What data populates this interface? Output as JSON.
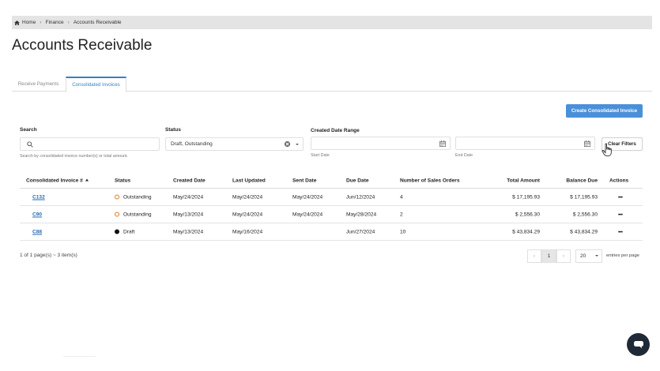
{
  "breadcrumb": {
    "home": "Home",
    "finance": "Finance",
    "current": "Accounts Receivable",
    "sep": "›"
  },
  "page": {
    "title": "Accounts Receivable"
  },
  "tabs": [
    {
      "label": "Receive Payments",
      "active": false
    },
    {
      "label": "Consolidated Invoices",
      "active": true
    }
  ],
  "actions": {
    "create_label": "Create Consolidated Invoice",
    "clear_label": "Clear Filters"
  },
  "filters": {
    "search_label": "Search",
    "search_value": "",
    "search_hint": "Search by consolidated invoice number(s) or total amount.",
    "status_label": "Status",
    "status_value": "Draft, Outstanding",
    "date_label": "Created Date Range",
    "start_hint": "Start Date",
    "end_hint": "End Date"
  },
  "table": {
    "columns": [
      "Consolidated Invoice #",
      "Status",
      "Created Date",
      "Last Updated",
      "Sent Date",
      "Due Date",
      "Number of Sales Orders",
      "Total Amount",
      "Balance Due",
      "Actions"
    ],
    "rows": [
      {
        "invoice": "C132",
        "status": "Outstanding",
        "created": "May/24/2024",
        "updated": "May/24/2024",
        "sent": "May/24/2024",
        "due": "Jun/12/2024",
        "orders": "4",
        "total": "$ 17,195.93",
        "balance": "$ 17,195.93",
        "actions": "•••"
      },
      {
        "invoice": "C90",
        "status": "Outstanding",
        "created": "May/13/2024",
        "updated": "May/24/2024",
        "sent": "May/24/2024",
        "due": "May/28/2024",
        "orders": "2",
        "total": "$ 2,556.30",
        "balance": "$ 2,556.30",
        "actions": "•••"
      },
      {
        "invoice": "C88",
        "status": "Draft",
        "created": "May/13/2024",
        "updated": "May/16/2024",
        "sent": "",
        "due": "Jun/27/2024",
        "orders": "10",
        "total": "$ 43,834.29",
        "balance": "$ 43,834.29",
        "actions": "•••"
      }
    ]
  },
  "pagination": {
    "info": "1 of 1 page(s) ~ 3 item(s)",
    "prev": "‹",
    "page": "1",
    "next": "›",
    "per_page": "20",
    "per_page_label": "entries per page"
  },
  "colors": {
    "accent": "#4a90d9",
    "link": "#2a6db5",
    "outstanding": "#e07b1a",
    "draft": "#111111",
    "chat": "#1f2a36"
  }
}
